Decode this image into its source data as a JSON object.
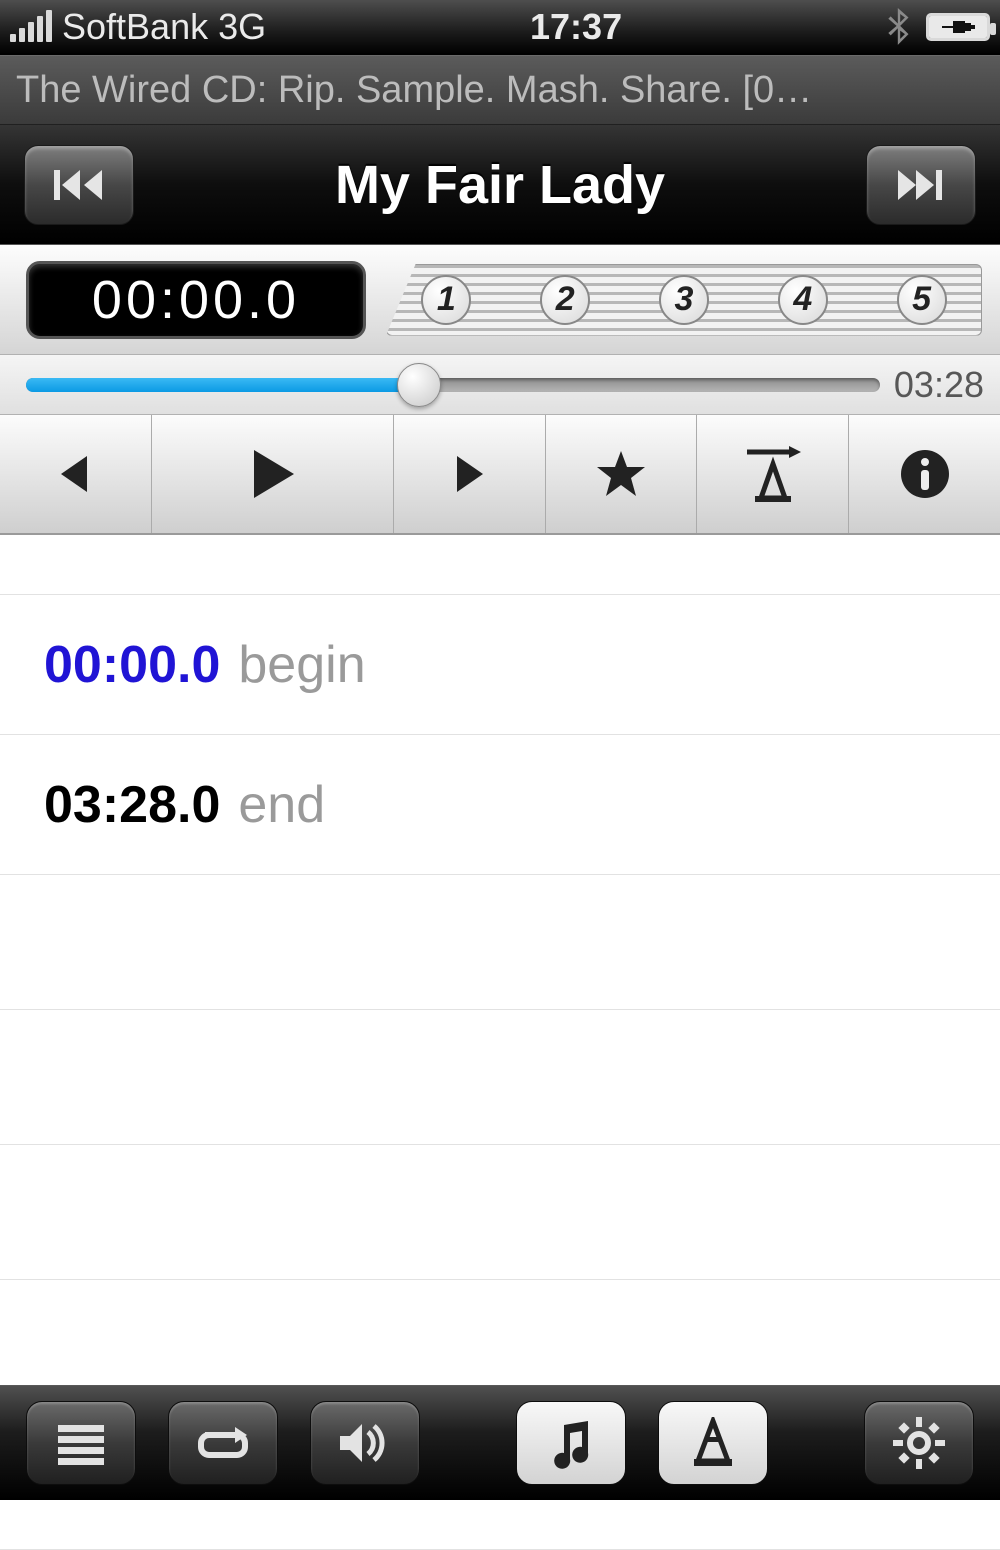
{
  "statusbar": {
    "carrier": "SoftBank",
    "network": "3G",
    "time": "17:37",
    "battery_percent": 100,
    "charging": true
  },
  "album": {
    "info_line": "The Wired CD: Rip. Sample. Mash. Share. [0…"
  },
  "nav": {
    "title": "My Fair Lady"
  },
  "timer": {
    "current": "00:00.0",
    "markers": [
      "1",
      "2",
      "3",
      "4",
      "5"
    ]
  },
  "progress": {
    "percent": 46,
    "duration": "03:28"
  },
  "marker_list": {
    "rows": [
      {
        "time": "00:00.0",
        "label": "begin",
        "kind": "begin"
      },
      {
        "time": "03:28.0",
        "label": "end",
        "kind": "end"
      }
    ]
  }
}
